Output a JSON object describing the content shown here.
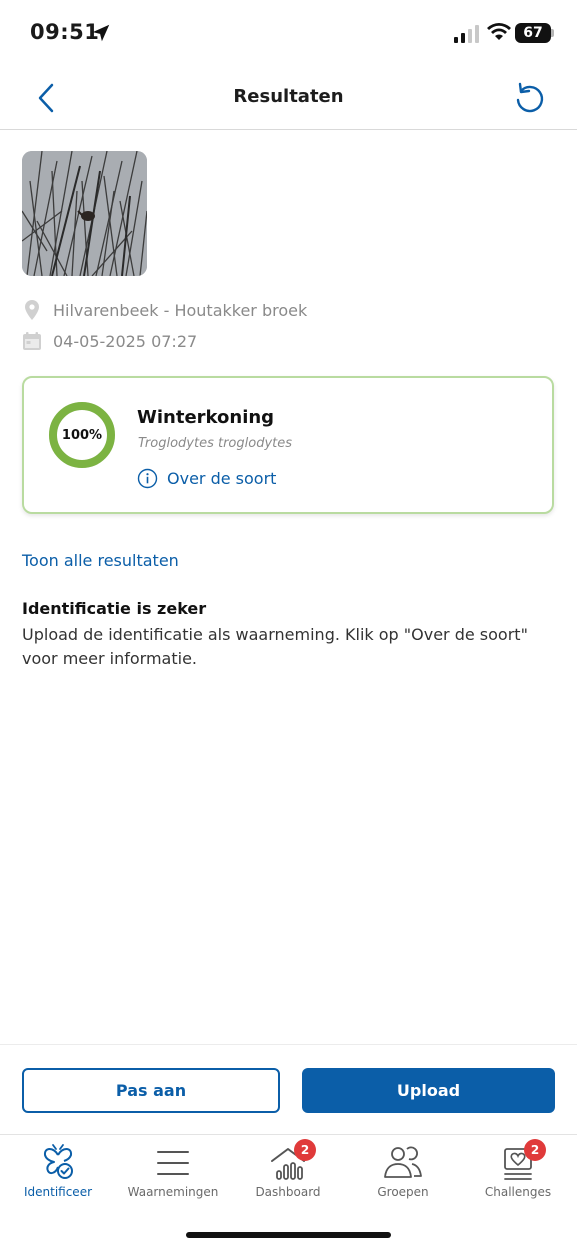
{
  "status_bar": {
    "time": "09:51",
    "battery": "67"
  },
  "nav": {
    "title": "Resultaten",
    "back_icon": "chevron-left-icon",
    "reset_icon": "undo-icon"
  },
  "observation": {
    "location": "Hilvarenbeek - Houtakker broek",
    "datetime": "04-05-2025 07:27"
  },
  "result": {
    "confidence_label": "100%",
    "confidence_value": 100,
    "species_name": "Winterkoning",
    "scientific_name": "Troglodytes troglodytes",
    "about_label": "Over de soort"
  },
  "show_all_label": "Toon alle resultaten",
  "identification": {
    "title": "Identificatie is zeker",
    "text": "Upload de identificatie als waarneming. Klik op \"Over de soort\" voor meer informatie."
  },
  "actions": {
    "edit_label": "Pas aan",
    "upload_label": "Upload"
  },
  "tabs": [
    {
      "label": "Identificeer",
      "icon": "butterfly-check-icon",
      "active": true
    },
    {
      "label": "Waarnemingen",
      "icon": "list-icon",
      "active": false
    },
    {
      "label": "Dashboard",
      "icon": "dashboard-icon",
      "badge": "2",
      "active": false
    },
    {
      "label": "Groepen",
      "icon": "group-icon",
      "active": false
    },
    {
      "label": "Challenges",
      "icon": "challenges-icon",
      "badge": "2",
      "active": false
    }
  ],
  "colors": {
    "accent": "#0b5ea8",
    "confidence_ring": "#7cb342",
    "card_border": "#b9dba0",
    "badge": "#e03a3a"
  }
}
